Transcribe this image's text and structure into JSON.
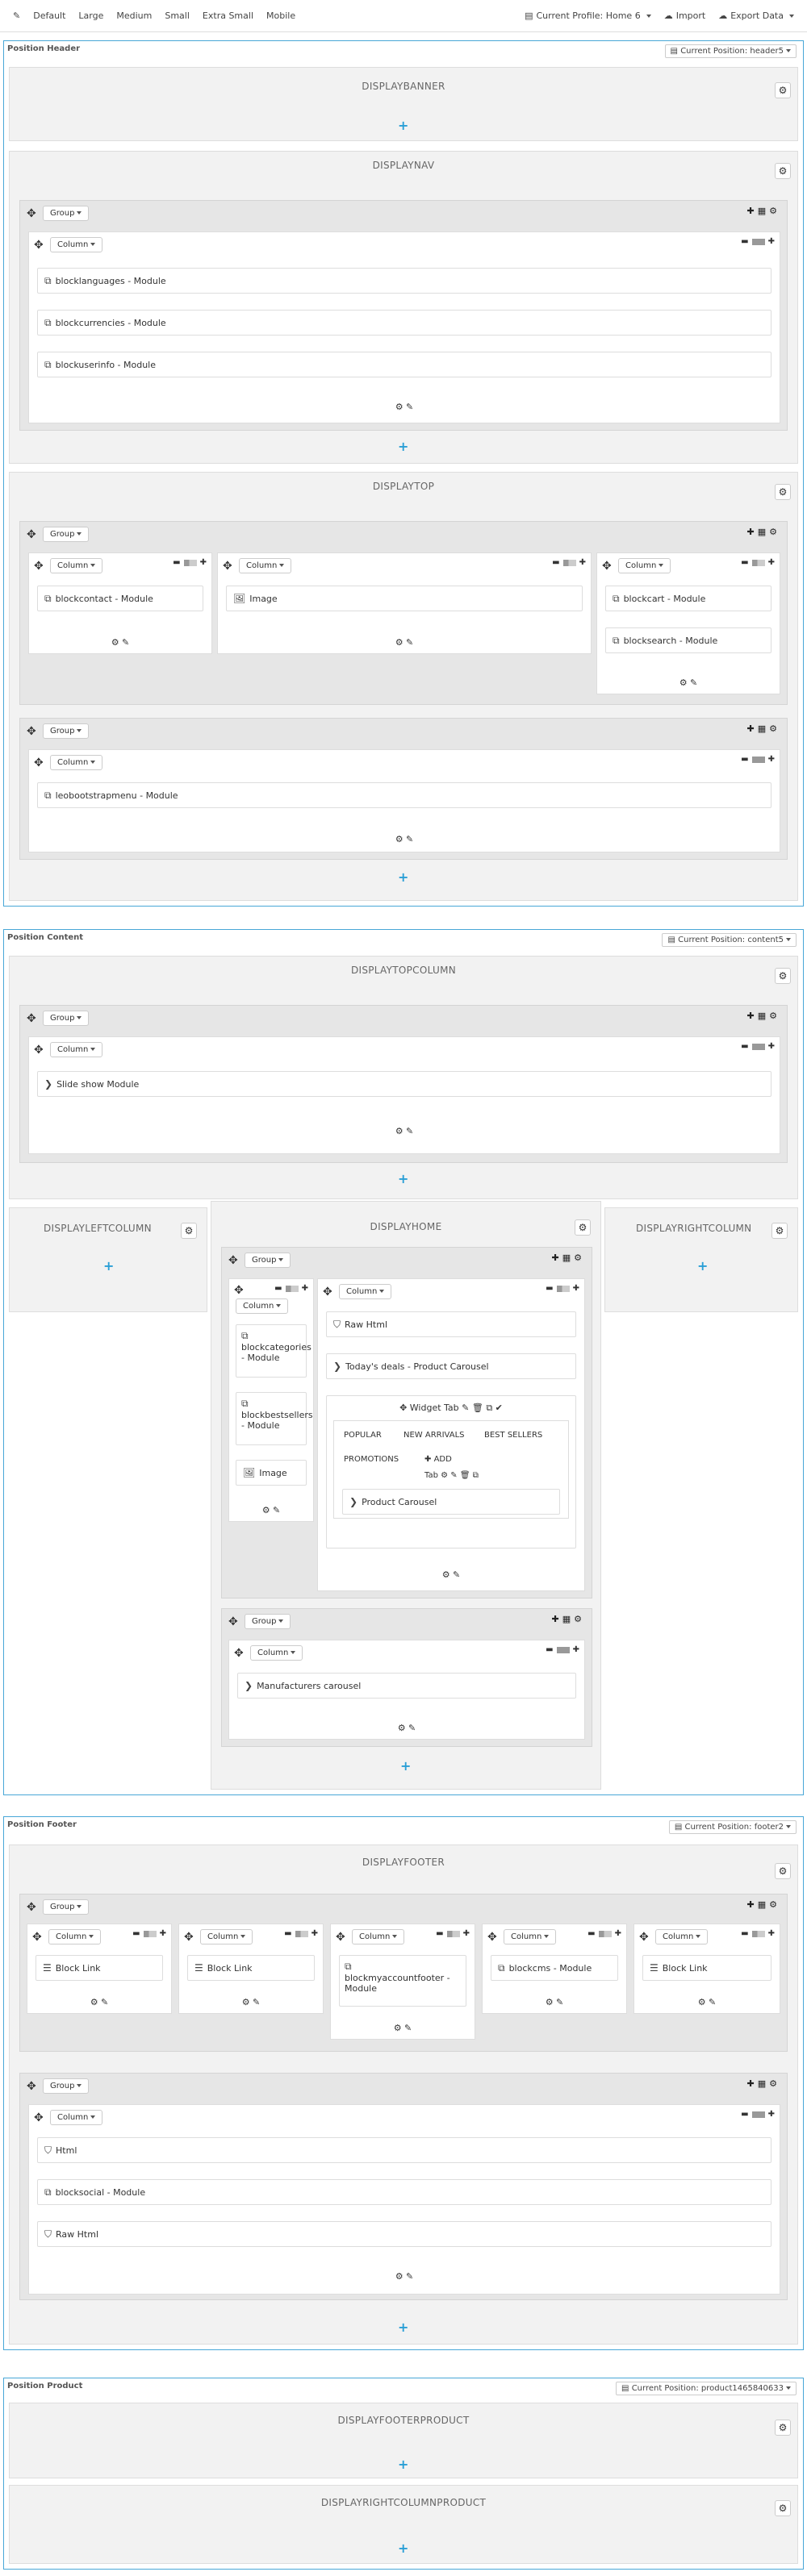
{
  "toolbar": {
    "tool_icon": "wrench-icon",
    "devices": [
      "Default",
      "Large",
      "Medium",
      "Small",
      "Extra Small",
      "Mobile"
    ],
    "profile": "Current Profile: Home 6",
    "import": "Import",
    "export": "Export Data"
  },
  "common": {
    "group": "Group",
    "column": "Column"
  },
  "positions": {
    "header": {
      "title": "Position Header",
      "current": "Current Position: header5"
    },
    "content": {
      "title": "Position Content",
      "current": "Current Position: content5"
    },
    "footer": {
      "title": "Position Footer",
      "current": "Current Position: footer2"
    },
    "product": {
      "title": "Position Product",
      "current": "Current Position: product1465840633"
    }
  },
  "hooks": {
    "displaybanner": "DISPLAYBANNER",
    "displaynav": "DISPLAYNAV",
    "displaytop": "DISPLAYTOP",
    "displaytopcolumn": "DISPLAYTOPCOLUMN",
    "displayleftcolumn": "DISPLAYLEFTCOLUMN",
    "displayhome": "DISPLAYHOME",
    "displayrightcolumn": "DISPLAYRIGHTCOLUMN",
    "displayfooter": "DISPLAYFOOTER",
    "displayfooterproduct": "DISPLAYFOOTERPRODUCT",
    "displayrightcolumnproduct": "DISPLAYRIGHTCOLUMNPRODUCT"
  },
  "modules": {
    "blocklanguages": "blocklanguages - Module",
    "blockcurrencies": "blockcurrencies - Module",
    "blockuserinfo": "blockuserinfo - Module",
    "blockcontact": "blockcontact - Module",
    "image": "Image",
    "blockcart": "blockcart - Module",
    "blocksearch": "blocksearch - Module",
    "leobootstrapmenu": "leobootstrapmenu - Module",
    "slideshow": "Slide show Module",
    "blockcategories": "blockcategories - Module",
    "blockbestsellers": "blockbestsellers - Module",
    "rawhtml": "Raw Html",
    "todaysdeals": "Today's deals - Product Carousel",
    "widgettab": "Widget Tab",
    "productcarousel": "Product Carousel",
    "manufacturers": "Manufacturers carousel",
    "blocklink": "Block Link",
    "blockmyaccountfooter": "blockmyaccountfooter - Module",
    "blockcms": "blockcms - Module",
    "html": "Html",
    "blocksocial": "blocksocial - Module"
  },
  "widget_tabs": {
    "tabs": [
      "POPULAR",
      "NEW ARRIVALS",
      "BEST SELLERS",
      "PROMOTIONS"
    ],
    "add": "ADD",
    "tab": "Tab"
  }
}
